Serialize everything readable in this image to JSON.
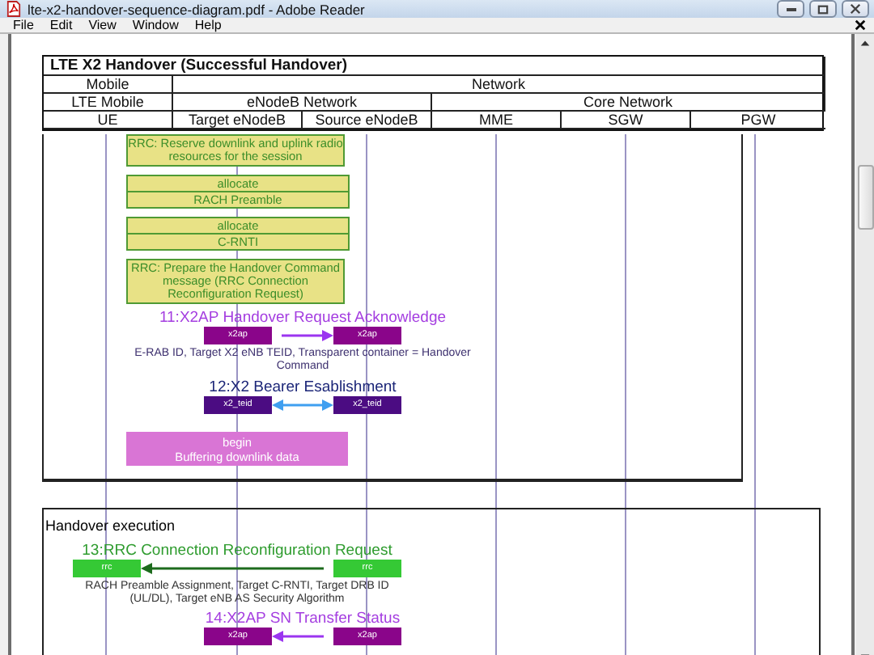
{
  "window": {
    "title": "lte-x2-handover-sequence-diagram.pdf - Adobe Reader"
  },
  "menu": [
    "File",
    "Edit",
    "View",
    "Window",
    "Help"
  ],
  "diagram": {
    "title": "LTE X2 Handover (Successful Handover)",
    "groups": [
      {
        "label": "Mobile",
        "subgroups": [
          {
            "label": "LTE Mobile",
            "lanes": [
              "UE"
            ]
          }
        ]
      },
      {
        "label": "Network",
        "subgroups": [
          {
            "label": "eNodeB Network",
            "lanes": [
              "Target eNodeB",
              "Source eNodeB"
            ]
          },
          {
            "label": "Core Network",
            "lanes": [
              "MME",
              "SGW",
              "PGW"
            ]
          }
        ]
      }
    ],
    "sections": [
      {
        "items": [
          {
            "kind": "note",
            "text": "RRC: Reserve downlink and uplink radio resources for the session"
          },
          {
            "kind": "split_note",
            "top": "allocate",
            "bottom": "RACH Preamble"
          },
          {
            "kind": "split_note",
            "top": "allocate",
            "bottom": "C-RNTI"
          },
          {
            "kind": "note",
            "text": "RRC: Prepare the Handover Command message (RRC Connection Reconfiguration Request)"
          },
          {
            "kind": "x2ap_enb_message",
            "label": "11:X2AP Handover Request Acknowledge",
            "leftward": false,
            "from_box": "x2ap",
            "to_box": "x2ap",
            "bidirectional": false,
            "detail": "E-RAB ID, Target X2 eNB TEID, Transparent container = Handover Command"
          },
          {
            "kind": "bearer_enb_message",
            "label": "12:X2 Bearer Esablishment",
            "leftward": false,
            "from_box": "x2_teid",
            "to_box": "x2_teid",
            "bidirectional": true
          },
          {
            "kind": "activity",
            "top": "begin",
            "bottom": "Buffering downlink data"
          }
        ]
      },
      {
        "label": "Handover execution",
        "items": [
          {
            "kind": "rrc_ue_message",
            "label": "13:RRC Connection Reconfiguration Request",
            "leftward": true,
            "from_box": "rrc",
            "to_box": "rrc",
            "bidirectional": false,
            "detail": "RACH Preamble Assignment, Target C-RNTI, Target DRB ID (UL/DL), Target eNB AS Security Algorithm"
          },
          {
            "kind": "x2ap_enb_message",
            "label": "14:X2AP SN Transfer Status",
            "leftward": true,
            "from_box": "x2ap",
            "to_box": "x2ap",
            "bidirectional": false
          }
        ]
      }
    ]
  }
}
